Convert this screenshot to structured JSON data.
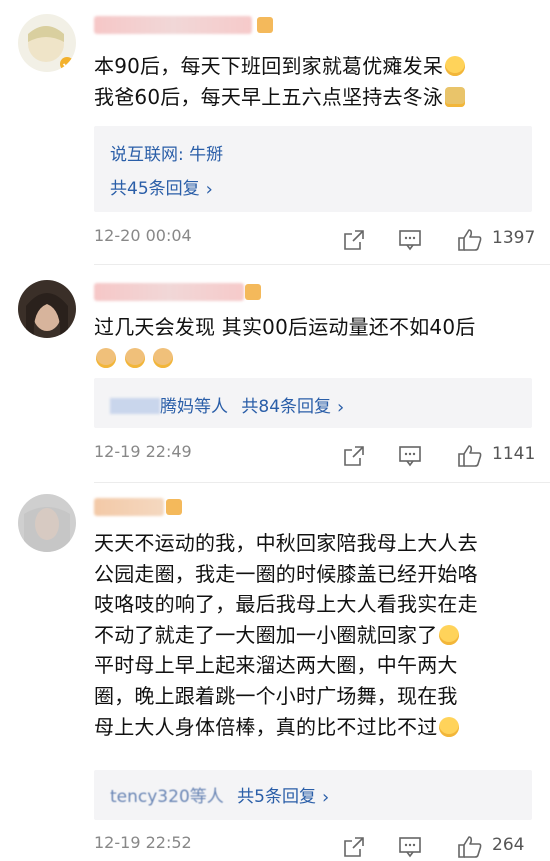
{
  "comments": [
    {
      "text_lines": [
        "本90后，每天下班回到家就葛优瘫发呆",
        "我爸60后，每天早上五六点坚持去冬泳"
      ],
      "reply_preview": "说互联网: 牛掰",
      "reply_count_label": "共45条回复",
      "time": "12-20 00:04",
      "likes": "1397"
    },
    {
      "text_lines": [
        "过几天会发现 其实00后运动量还不如40后"
      ],
      "reply_summary_names": "腾妈等人",
      "reply_count_label": "共84条回复",
      "time": "12-19 22:49",
      "likes": "1141"
    },
    {
      "text_lines": [
        "天天不运动的我，中秋回家陪我母上大人去",
        "公园走圈，我走一圈的时候膝盖已经开始咯",
        "吱咯吱的响了，最后我母上大人看我实在走",
        "不动了就走了一大圈加一小圈就回家了",
        "平时母上早上起来溜达两大圈，中午两大",
        "圈，晚上跟着跳一个小时广场舞，现在我",
        "母上大人身体倍棒，真的比不过比不过"
      ],
      "reply_summary_names": "tency320等人",
      "reply_count_label": "共5条回复",
      "time": "12-19 22:52",
      "likes": "264"
    }
  ],
  "icons": {
    "share": "share-icon",
    "comment": "comment-icon",
    "like": "thumbs-up-icon"
  },
  "colors": {
    "link": "#2a5ea8",
    "time": "#888888",
    "reply_bg": "#f4f4f6"
  }
}
